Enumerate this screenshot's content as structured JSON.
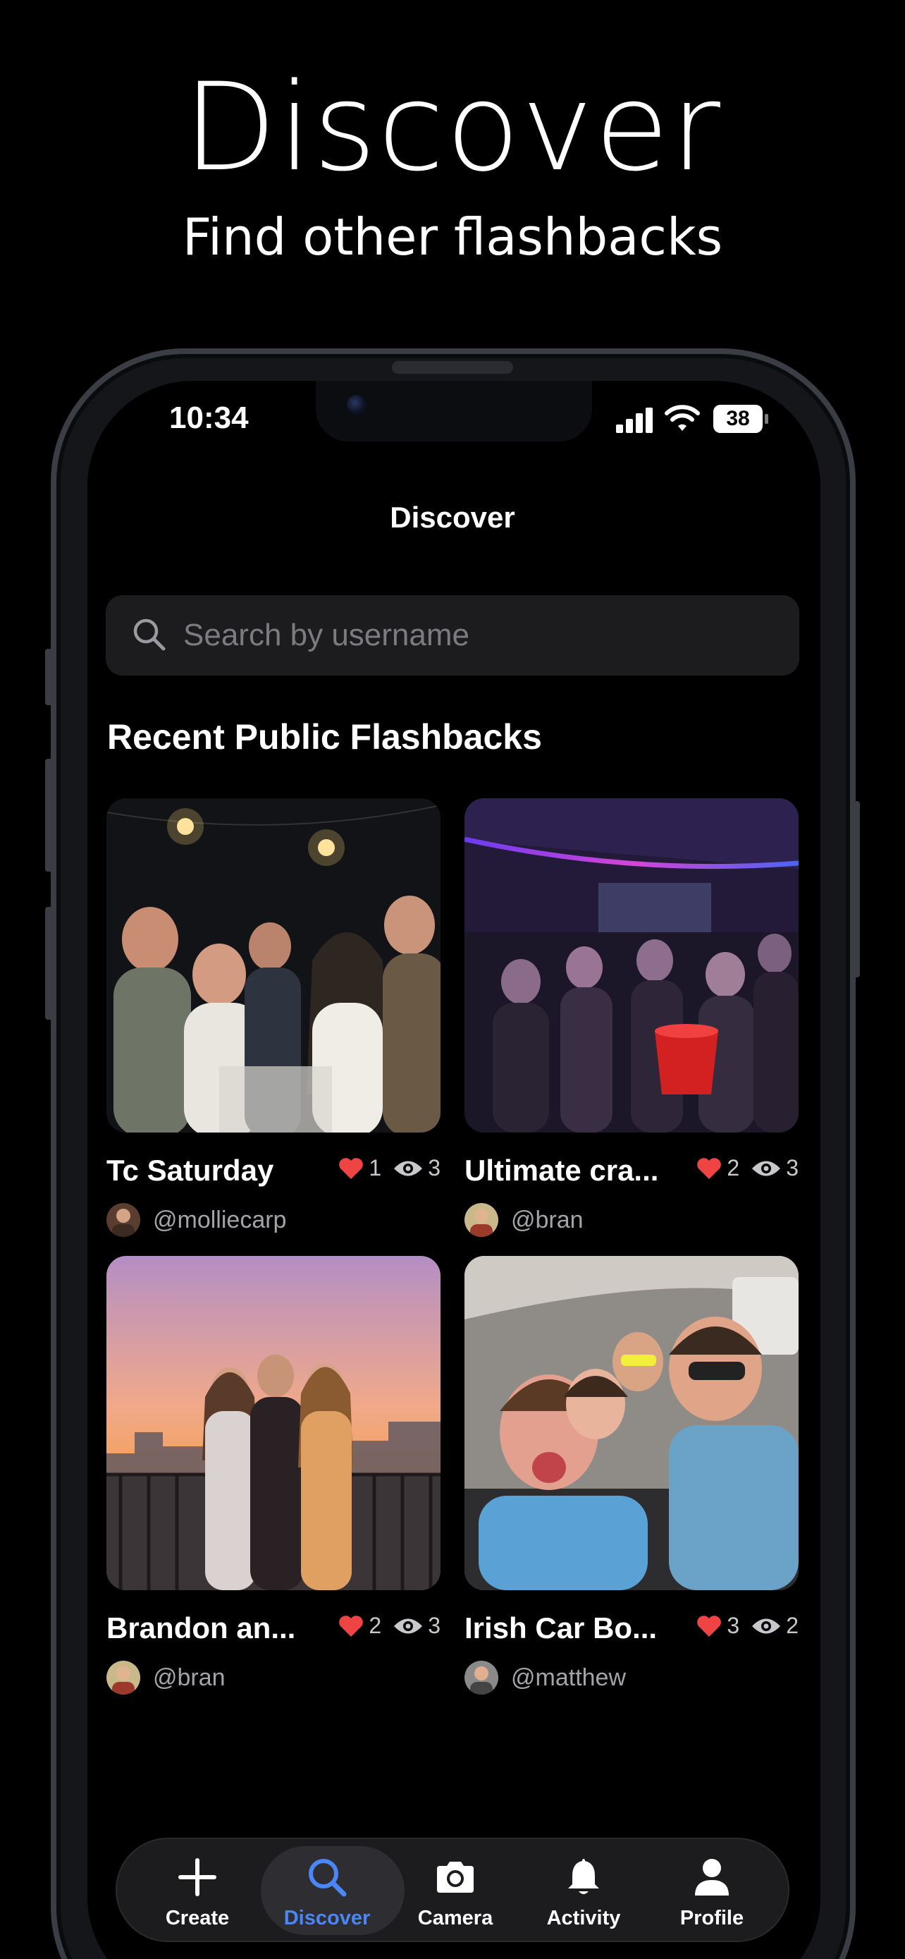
{
  "promo": {
    "title": "Discover",
    "subtitle": "Find other flashbacks"
  },
  "status_bar": {
    "time": "10:34",
    "battery": "38"
  },
  "nav": {
    "title": "Discover"
  },
  "search": {
    "placeholder": "Search by username",
    "value": ""
  },
  "section": {
    "title": "Recent Public Flashbacks"
  },
  "flashbacks": [
    {
      "title": "Tc Saturday",
      "likes": "1",
      "views": "3",
      "username": "@molliecarp",
      "scene": "night rooftop party, string lights"
    },
    {
      "title": "Ultimate cra...",
      "likes": "2",
      "views": "3",
      "username": "@bran",
      "scene": "house party with pink neon lights"
    },
    {
      "title": "Brandon an...",
      "likes": "2",
      "views": "3",
      "username": "@bran",
      "scene": "sunset balcony group photo"
    },
    {
      "title": "Irish Car Bo...",
      "likes": "3",
      "views": "2",
      "username": "@matthew",
      "scene": "car selfie with sunglasses"
    }
  ],
  "tabs": [
    {
      "label": "Create",
      "icon": "plus-icon",
      "active": false
    },
    {
      "label": "Discover",
      "icon": "search-icon",
      "active": true
    },
    {
      "label": "Camera",
      "icon": "camera-icon",
      "active": false
    },
    {
      "label": "Activity",
      "icon": "bell-icon",
      "active": false
    },
    {
      "label": "Profile",
      "icon": "person-icon",
      "active": false
    }
  ],
  "colors": {
    "accent": "#4a86f5",
    "heart": "#ef4444",
    "background": "#000000",
    "surface": "#1c1c1e"
  }
}
